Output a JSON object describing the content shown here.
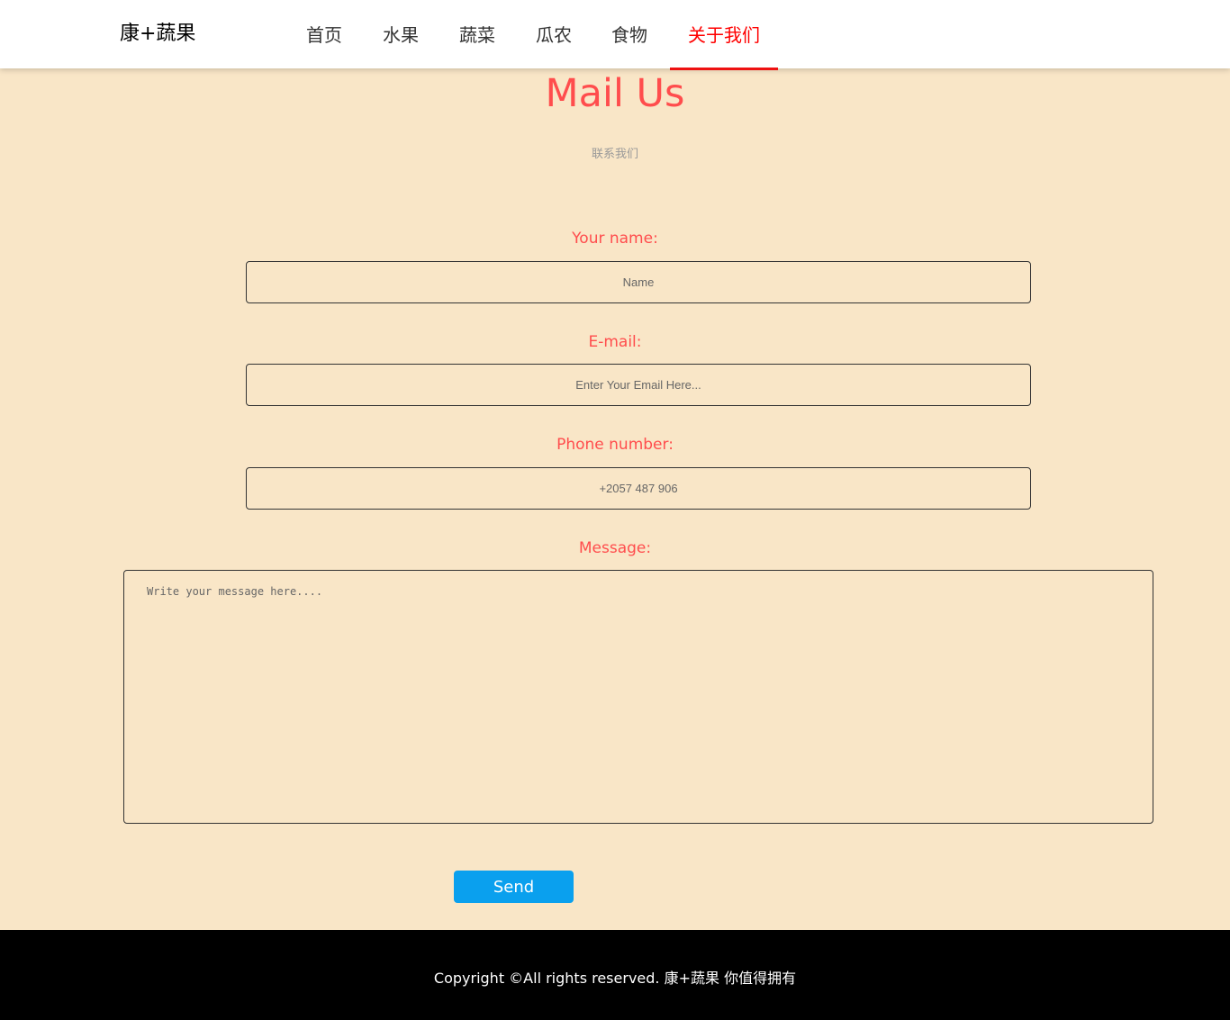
{
  "header": {
    "logo": "康+蔬果",
    "nav": [
      {
        "label": "首页"
      },
      {
        "label": "水果"
      },
      {
        "label": "蔬菜"
      },
      {
        "label": "瓜农"
      },
      {
        "label": "食物"
      },
      {
        "label": "关于我们",
        "active": true
      }
    ]
  },
  "main": {
    "title": "Mail Us",
    "subtitle": "联系我们"
  },
  "form": {
    "name_label": "Your name:",
    "name_placeholder": "Name",
    "email_label": "E-mail:",
    "email_placeholder": "Enter Your Email Here...",
    "phone_label": "Phone number:",
    "phone_placeholder": "+2057 487 906",
    "message_label": "Message:",
    "message_placeholder": "Write your message here....",
    "send_label": "Send"
  },
  "footer": {
    "text": "Copyright ©All rights reserved. 康+蔬果 你值得拥有"
  },
  "colors": {
    "background": "#f9e6c7",
    "accent": "#ff4d4d",
    "active_nav": "#ff0000",
    "button": "#0aa0ee",
    "footer": "#000000"
  }
}
